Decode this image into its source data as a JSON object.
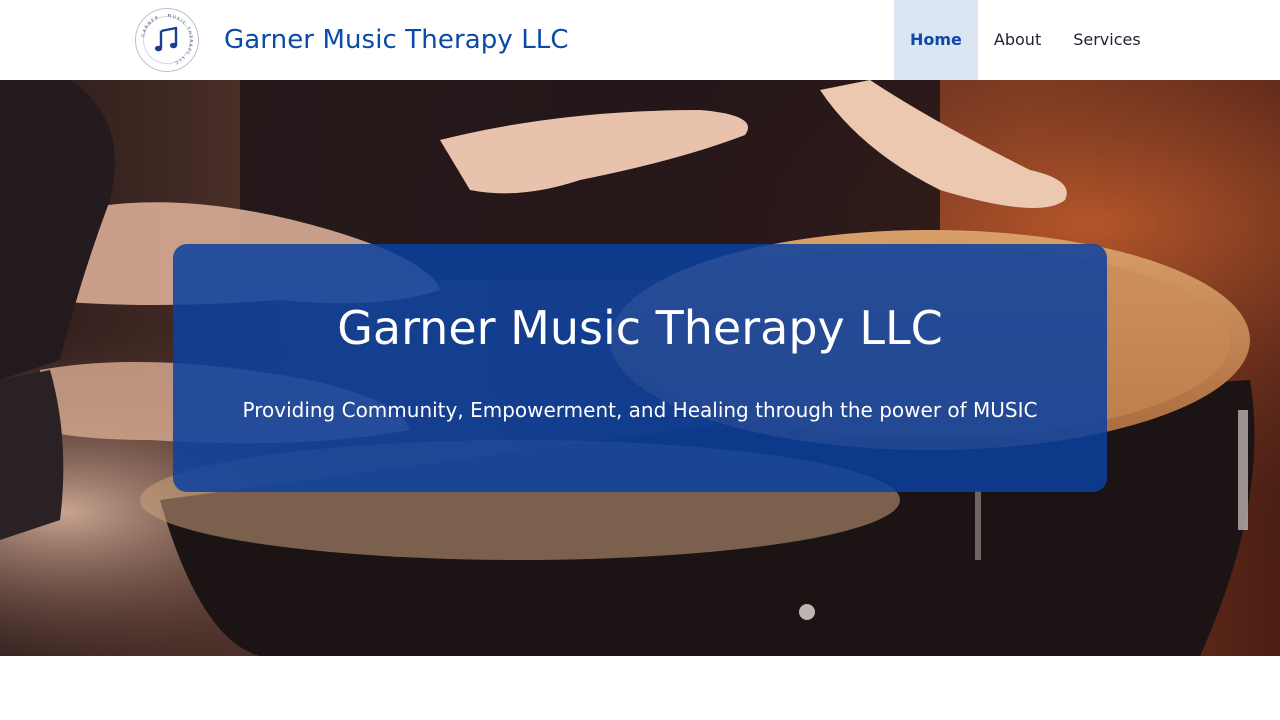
{
  "header": {
    "site_title": "Garner Music Therapy LLC",
    "logo": {
      "icon": "music-note-icon",
      "ring_text": "GARNER MUSIC THERAPY LLC"
    }
  },
  "nav": {
    "items": [
      {
        "label": "Home",
        "active": true
      },
      {
        "label": "About",
        "active": false
      },
      {
        "label": "Services",
        "active": false
      }
    ]
  },
  "hero": {
    "background_image": "hands-on-conga-drums",
    "title": "Garner Music Therapy LLC",
    "subtitle": "Providing Community, Empowerment, and Healing through the power of MUSIC"
  },
  "colors": {
    "brand_blue": "#0b4aa6",
    "nav_active_bg": "#dce6f3",
    "hero_box": "#0a40a0"
  }
}
